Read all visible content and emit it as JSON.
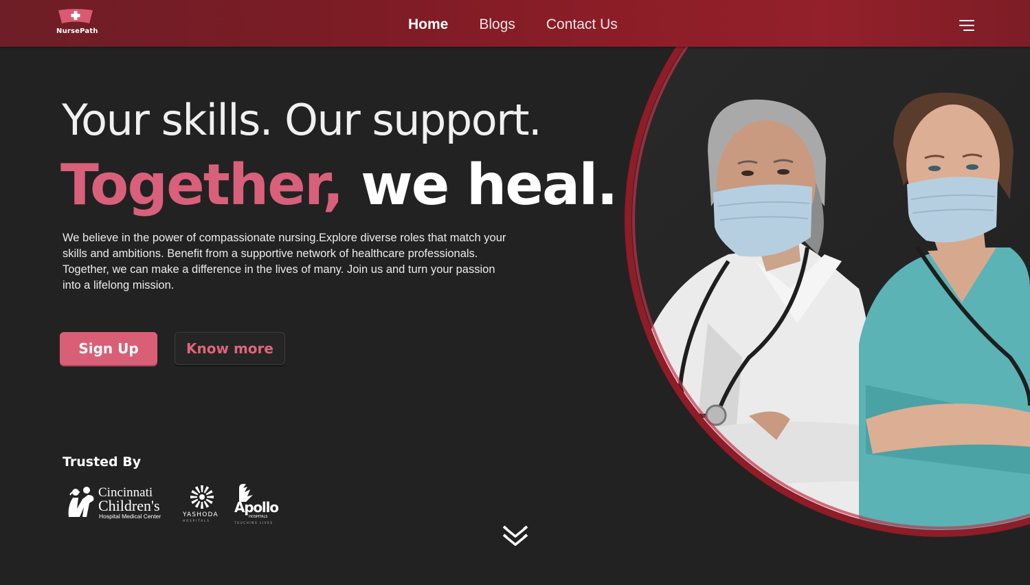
{
  "brand": {
    "name": "NursePath",
    "accent_color": "#d9607a",
    "header_color": "#8c1d27"
  },
  "nav": {
    "items": [
      {
        "label": "Home",
        "active": true
      },
      {
        "label": "Blogs",
        "active": false
      },
      {
        "label": "Contact Us",
        "active": false
      }
    ],
    "menu_icon": "hamburger-menu-icon"
  },
  "hero": {
    "headline_line1": "Your skills. Our support.",
    "headline_accent": "Together,",
    "headline_rest": " we heal.",
    "description": "We believe in the power of compassionate nursing.Explore diverse roles that match your skills and ambitions. Benefit from a supportive network of healthcare professionals. Together, we can make a difference in the lives of many. Join us and turn your passion into a lifelong mission.",
    "primary_button": "Sign Up",
    "secondary_button": "Know more",
    "image_description": "two-nurses-with-masks-and-stethoscopes"
  },
  "trusted": {
    "title": "Trusted By",
    "partners": {
      "cincinnati": {
        "line1": "Cincinnati",
        "line2": "Children's",
        "line3": "Hospital Medical Center"
      },
      "yashoda": {
        "name": "YASHODA",
        "sub": "HOSPITALS"
      },
      "apollo": {
        "name": "Apollo",
        "sub": "HOSPITALS",
        "tagline": "TOUCHING LIVES"
      }
    }
  },
  "scroll_icon": "double-chevron-down-icon"
}
